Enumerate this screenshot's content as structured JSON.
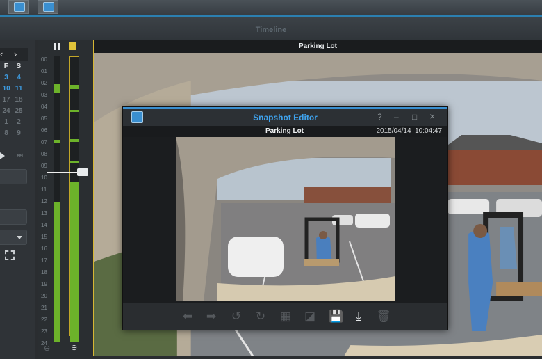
{
  "app": {
    "panel_title": "Timeline",
    "main_camera_label": "Parking Lot"
  },
  "calendar": {
    "prev": "‹",
    "next": "›",
    "headers": [
      "F",
      "S"
    ],
    "rows": [
      [
        "3",
        "4"
      ],
      [
        "10",
        "11"
      ],
      [
        "17",
        "18"
      ],
      [
        "24",
        "25"
      ],
      [
        "1",
        "2"
      ],
      [
        "8",
        "9"
      ]
    ]
  },
  "timeline": {
    "hours": [
      "00",
      "01",
      "02",
      "03",
      "04",
      "05",
      "06",
      "07",
      "08",
      "09",
      "10",
      "11",
      "12",
      "13",
      "14",
      "15",
      "16",
      "17",
      "18",
      "19",
      "20",
      "21",
      "22",
      "23",
      "24"
    ],
    "current_marker_hour": "10"
  },
  "dialog": {
    "title": "Snapshot Editor",
    "help": "?",
    "minimize": "–",
    "maximize": "□",
    "close": "×",
    "camera": "Parking Lot",
    "timestamp": "2015/04/14  10:04:47",
    "tools": {
      "prev": "arrow-left-icon",
      "next": "arrow-right-icon",
      "rotate_left": "rotate-left-icon",
      "rotate_right": "rotate-right-icon",
      "mosaic": "mosaic-icon",
      "crop": "crop-icon",
      "save": "save-icon",
      "download": "download-icon",
      "delete": "trash-icon"
    }
  },
  "colors": {
    "accent": "#3a8fd0",
    "title_blue": "#3fa3ee",
    "highlight_border": "#d6b634",
    "recording_green": "#6cb22a"
  }
}
